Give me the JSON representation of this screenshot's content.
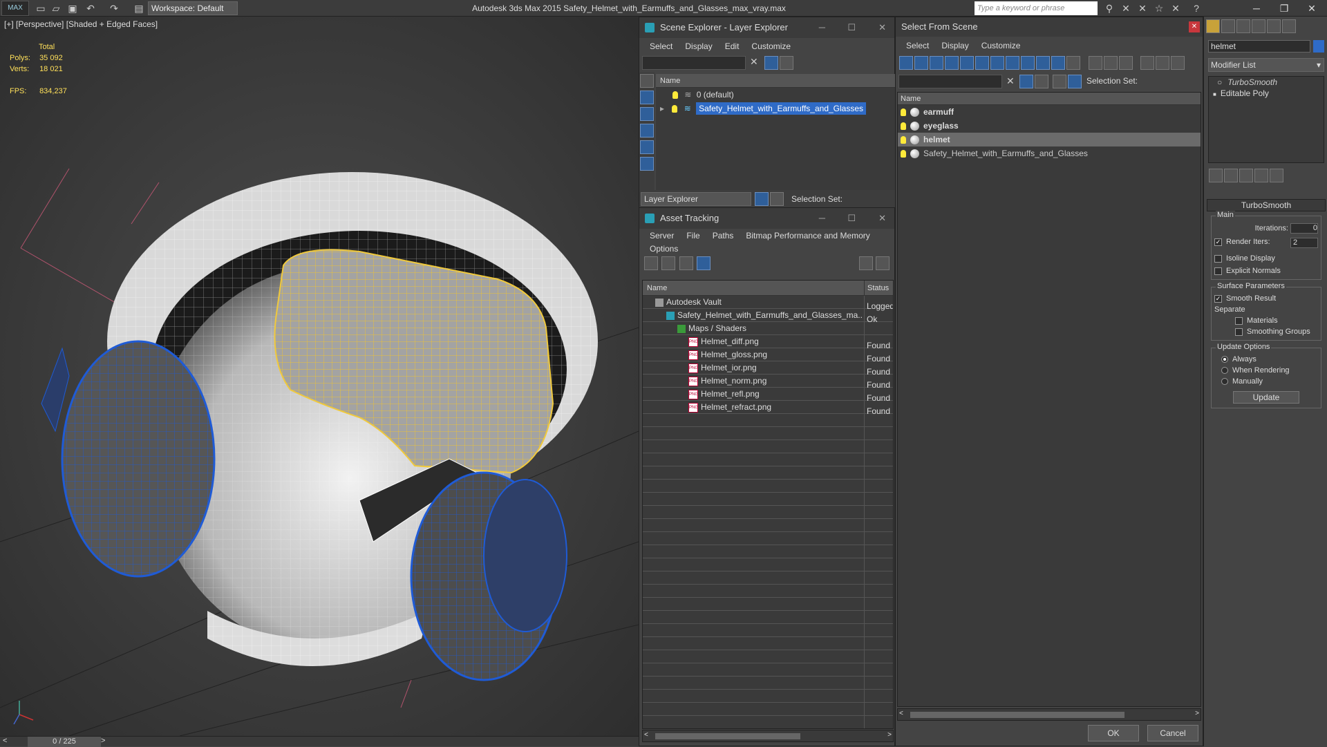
{
  "titlebar": {
    "logo": "MAX",
    "workspace": "Workspace: Default",
    "app_title": "Autodesk 3ds Max  2015     Safety_Helmet_with_Earmuffs_and_Glasses_max_vray.max",
    "search_placeholder": "Type a keyword or phrase"
  },
  "viewport": {
    "label": "[+] [Perspective] [Shaded + Edged Faces]",
    "stats": {
      "total_label": "Total",
      "polys_label": "Polys:",
      "polys": "35 092",
      "verts_label": "Verts:",
      "verts": "18 021",
      "fps_label": "FPS:",
      "fps": "834,237"
    },
    "frame_counter": "0 / 225"
  },
  "scene_explorer": {
    "title": "Scene Explorer - Layer Explorer",
    "menu": [
      "Select",
      "Display",
      "Edit",
      "Customize"
    ],
    "column": "Name",
    "rows": [
      "0 (default)",
      "Safety_Helmet_with_Earmuffs_and_Glasses"
    ],
    "footer_dropdown": "Layer Explorer",
    "selection_set": "Selection Set:"
  },
  "asset_tracking": {
    "title": "Asset Tracking",
    "menu": [
      "Server",
      "File",
      "Paths",
      "Bitmap Performance and Memory"
    ],
    "menu2": "Options",
    "col_name": "Name",
    "col_status": "Status",
    "rows": [
      {
        "name": "Autodesk Vault",
        "status": "Logged",
        "indent": 0
      },
      {
        "name": "Safety_Helmet_with_Earmuffs_and_Glasses_ma...",
        "status": "Ok",
        "indent": 1
      },
      {
        "name": "Maps / Shaders",
        "status": "",
        "indent": 2
      },
      {
        "name": "Helmet_diff.png",
        "status": "Found",
        "indent": 3
      },
      {
        "name": "Helmet_gloss.png",
        "status": "Found",
        "indent": 3
      },
      {
        "name": "Helmet_ior.png",
        "status": "Found",
        "indent": 3
      },
      {
        "name": "Helmet_norm.png",
        "status": "Found",
        "indent": 3
      },
      {
        "name": "Helmet_refl.png",
        "status": "Found",
        "indent": 3
      },
      {
        "name": "Helmet_refract.png",
        "status": "Found",
        "indent": 3
      }
    ]
  },
  "select_from_scene": {
    "title": "Select From Scene",
    "menu": [
      "Select",
      "Display",
      "Customize"
    ],
    "selection_set": "Selection Set:",
    "column": "Name",
    "rows": [
      {
        "name": "earmuff",
        "bold": true,
        "selected": false
      },
      {
        "name": "eyeglass",
        "bold": true,
        "selected": false
      },
      {
        "name": "helmet",
        "bold": true,
        "selected": true
      },
      {
        "name": "Safety_Helmet_with_Earmuffs_and_Glasses",
        "bold": false,
        "selected": false
      }
    ],
    "ok": "OK",
    "cancel": "Cancel"
  },
  "command_panel": {
    "object_name": "helmet",
    "modifier_list": "Modifier List",
    "stack": [
      "TurboSmooth",
      "Editable Poly"
    ],
    "rollout": "TurboSmooth",
    "main": "Main",
    "iterations_label": "Iterations:",
    "iterations": "0",
    "render_iters_label": "Render Iters:",
    "render_iters": "2",
    "isoline": "Isoline Display",
    "explicit": "Explicit Normals",
    "surface": "Surface Parameters",
    "smooth_result": "Smooth Result",
    "separate": "Separate",
    "materials": "Materials",
    "smoothing_groups": "Smoothing Groups",
    "update_options": "Update Options",
    "always": "Always",
    "when_rendering": "When Rendering",
    "manually": "Manually",
    "update": "Update"
  }
}
